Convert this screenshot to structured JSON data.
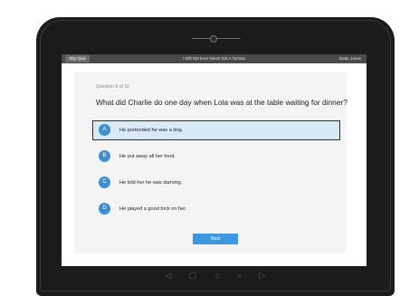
{
  "topbar": {
    "skip_label": "Skip Quiz",
    "title": "I Will Not Ever Never Eat A Tomato",
    "user": "Swan Jones"
  },
  "quiz": {
    "counter": "Question 8 of 10",
    "question": "What did Charlie do one day when Lola was at the table waiting for dinner?",
    "answers": [
      {
        "letter": "A",
        "text": "He pretended he was a dog.",
        "selected": true
      },
      {
        "letter": "B",
        "text": "He put away all her food.",
        "selected": false
      },
      {
        "letter": "C",
        "text": "He told her he was starving.",
        "selected": false
      },
      {
        "letter": "D",
        "text": "He played a good trick on her.",
        "selected": false
      }
    ],
    "next_label": "Next"
  },
  "nav_icons": [
    "back-icon",
    "recent-apps-icon",
    "home-icon",
    "search-icon",
    "forward-icon"
  ],
  "colors": {
    "accent": "#3c8fd3",
    "selected_bg": "#d8eaf6",
    "topbar": "#4a4a4a"
  }
}
